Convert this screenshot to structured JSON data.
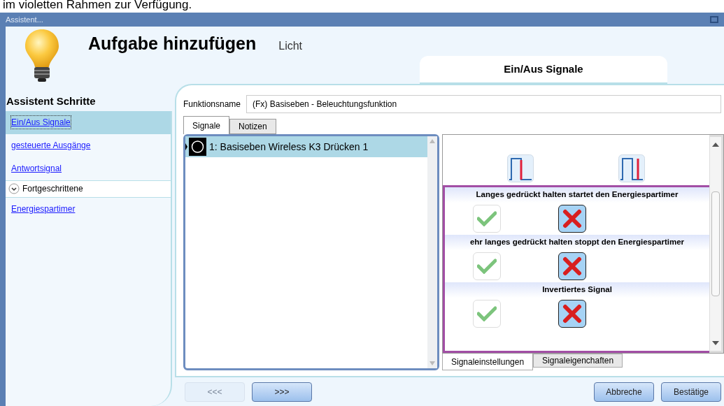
{
  "caption": "im violetten Rahmen zur Verfügung.",
  "window": {
    "title": "Assistent..."
  },
  "header": {
    "title": "Aufgabe hinzufügen",
    "category": "Licht",
    "step_title": "Ein/Aus Signale"
  },
  "sidebar": {
    "title": "Assistent Schritte",
    "items": [
      {
        "label": "Ein/Aus Signale",
        "selected": true
      },
      {
        "label": "gesteuerte Ausgänge",
        "selected": false
      },
      {
        "label": "Antwortsignal",
        "selected": false
      }
    ],
    "advanced": {
      "label": "Fortgeschrittene",
      "expanded": true,
      "items": [
        {
          "label": "Energiespartimer",
          "selected": false
        }
      ]
    }
  },
  "function_name": {
    "label": "Funktionsname",
    "value": "(Fx) Basiseben - Beleuchtungsfunktion"
  },
  "tabs": [
    {
      "label": "Signale",
      "selected": true
    },
    {
      "label": "Notizen",
      "selected": false
    }
  ],
  "signals": [
    {
      "label": "1: Basiseben Wireless K3 Drücken 1",
      "selected": true
    }
  ],
  "options": [
    {
      "label": "Langes gedrückt halten startet den Energiespartimer",
      "enabled": false
    },
    {
      "label": "ehr langes gedrückt halten stoppt den Energiespartimer",
      "enabled": false
    },
    {
      "label": "Invertiertes Signal",
      "enabled": false
    }
  ],
  "settings_tabs": [
    {
      "label": "Signaleinstellungen",
      "selected": true
    },
    {
      "label": "Signaleigenchaften",
      "selected": false
    }
  ],
  "buttons": [
    {
      "label": "<<<",
      "disabled": true
    },
    {
      "label": ">>>",
      "disabled": false
    },
    {
      "label": "Abbreche",
      "disabled": false
    },
    {
      "label": "Bestätige",
      "disabled": false
    }
  ]
}
